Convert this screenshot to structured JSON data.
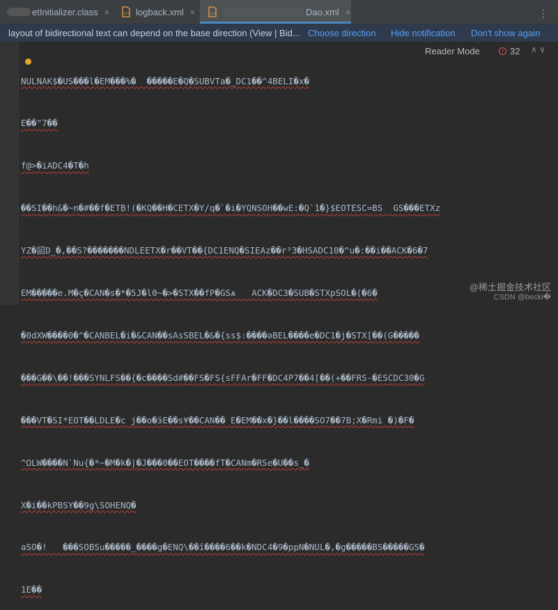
{
  "tabs": [
    {
      "label": "etInitializer.class",
      "icon": "class-file-icon",
      "active": false
    },
    {
      "label": "logback.xml",
      "icon": "xml-file-icon",
      "active": false
    },
    {
      "label": "Dao.xml",
      "icon": "xml-file-icon",
      "active": true
    }
  ],
  "tab_close": "×",
  "tabbar_menu": "⋮",
  "banner": {
    "message": "layout of bidirectional text can depend on the base direction (View | Bid...",
    "choose_direction": "Choose direction",
    "hide_notification": "Hide notification",
    "dont_show_again": "Don't show again"
  },
  "editor": {
    "reader_mode": "Reader Mode",
    "error_count": "32",
    "error_icon": "error-icon",
    "nav_arrows": "∧ ∨",
    "lines": [
      "NULNAK$�US���l�EM���%�  �����E�Q�SUBVTa�_DC1��^4BELI�x�",
      "E��\"7��",
      "f@>�iADC4�T�h",
      "��SI��h&�~n�#��f�ETB!(�KQ��H�CETX�Y/q�`�i�YQNSOH��wE:�Q`1�}$EOTESC=BS  GS���ETXz",
      "YZ�詔D_�,��S?�������NDLEETX�r��VT��{DC1ENQ�SIEAz��r³3�HSADC10�^u�:��i��ACK�6�7",
      "EM�����e.M�ç�CAN�s�*�5J�l0~�>�STX��fP�GSѧ   ACK�DC3�SUB�STXpSOL�(�6�",
      "�0dXW����0�^�CANBEL�i�&CAN��sAsSBEL�&�{ss$:����ǝBEL����e�DC1�j�STX[��(G�����",
      "���G��\\��!���SYNLFS��{�c����Sd#��FS�FS{sFFAr�FF�DC4P7��4[��(+��FRS-�ESCDC30�G",
      "���VT�SI*EOT��LDLE�c j��o�ӭE��s¥��CAN�� E�EM��x�}��l����SO7��7B;X�Rmi �)�F�",
      "^ΩLW����N`Nu{�*~�M�k�|�J���0��EOT����fT�CANm�RSe�U��s_�",
      "X�i��kPBSY��9g\\SOHENQ�",
      "aSO�!   ���SOBSu�����_����g�ENQ\\��î����6��k�NDC4�9�ppN�NUL�,�g�����BS�����GS�",
      "1E��"
    ]
  },
  "watermark": {
    "line1": "@稀土掘金技术社区",
    "line2": "CSDN @becki�"
  },
  "colors": {
    "accent": "#4a88c7",
    "link": "#589df6",
    "error": "#bc3f3c",
    "banner_bg": "#2f3b4d",
    "editor_bg": "#2b2b2b"
  }
}
